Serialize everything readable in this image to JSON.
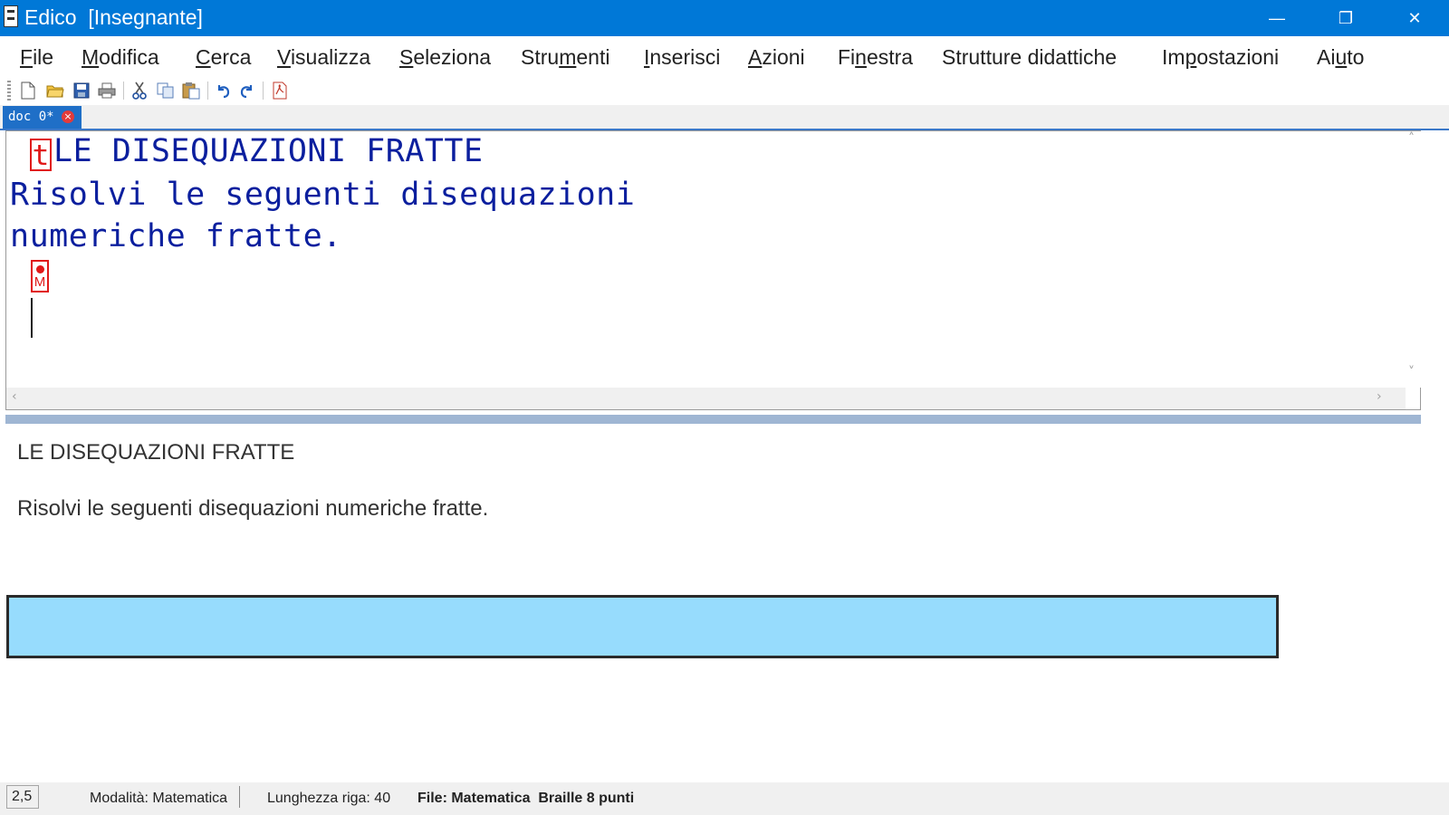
{
  "window": {
    "app_name": "Edico",
    "title": "Edico  [Insegnante]",
    "buttons": {
      "minimize": "—",
      "restore": "❐",
      "close": "✕"
    }
  },
  "menu": [
    {
      "id": "file",
      "pre": "",
      "key": "F",
      "post": "ile"
    },
    {
      "id": "modifica",
      "pre": "",
      "key": "M",
      "post": "odifica"
    },
    {
      "id": "cerca",
      "pre": "",
      "key": "C",
      "post": "erca"
    },
    {
      "id": "visualizza",
      "pre": "",
      "key": "V",
      "post": "isualizza"
    },
    {
      "id": "seleziona",
      "pre": "",
      "key": "S",
      "post": "eleziona"
    },
    {
      "id": "strumenti",
      "pre": "Stru",
      "key": "m",
      "post": "enti"
    },
    {
      "id": "inserisci",
      "pre": "",
      "key": "I",
      "post": "nserisci"
    },
    {
      "id": "azioni",
      "pre": "",
      "key": "A",
      "post": "zioni"
    },
    {
      "id": "finestra",
      "pre": "Fi",
      "key": "n",
      "post": "estra"
    },
    {
      "id": "strutture-didattiche",
      "pre": "Strutture didattiche",
      "key": "",
      "post": ""
    },
    {
      "id": "impostazioni",
      "pre": "Im",
      "key": "p",
      "post": "ostazioni"
    },
    {
      "id": "aiuto",
      "pre": "Ai",
      "key": "u",
      "post": "to"
    }
  ],
  "toolbar": [
    {
      "name": "new-document-icon",
      "glyph": "🗋"
    },
    {
      "name": "open-folder-icon",
      "glyph": "📂"
    },
    {
      "name": "save-icon",
      "glyph": "💾"
    },
    {
      "name": "print-icon",
      "glyph": "🖨"
    },
    {
      "name": "cut-icon",
      "glyph": "✂"
    },
    {
      "name": "copy-icon",
      "glyph": "⧉"
    },
    {
      "name": "paste-icon",
      "glyph": "📋"
    },
    {
      "name": "undo-icon",
      "glyph": "↶"
    },
    {
      "name": "redo-icon",
      "glyph": "↷"
    },
    {
      "name": "pdf-icon",
      "glyph": "⎙"
    }
  ],
  "tab": {
    "label": "doc 0*",
    "close": "×"
  },
  "editor": {
    "title_marker": "t",
    "lines": [
      "LE DISEQUAZIONI FRATTE",
      "Risolvi le seguenti disequazioni",
      "numeriche fratte."
    ],
    "math_marker": "M"
  },
  "preview": {
    "title": "LE DISEQUAZIONI FRATTE",
    "paragraph": "Risolvi le seguenti disequazioni numeriche fratte."
  },
  "status": {
    "position": "2,5",
    "mode": "Modalità: Matematica",
    "line_length": "Lunghezza riga: 40",
    "file": "File: Matematica  Braille 8 punti"
  },
  "colors": {
    "titlebar": "#0078d7",
    "braille_text": "#0b1f9e",
    "marker": "#e01818",
    "math_box": "#97dcfd"
  }
}
